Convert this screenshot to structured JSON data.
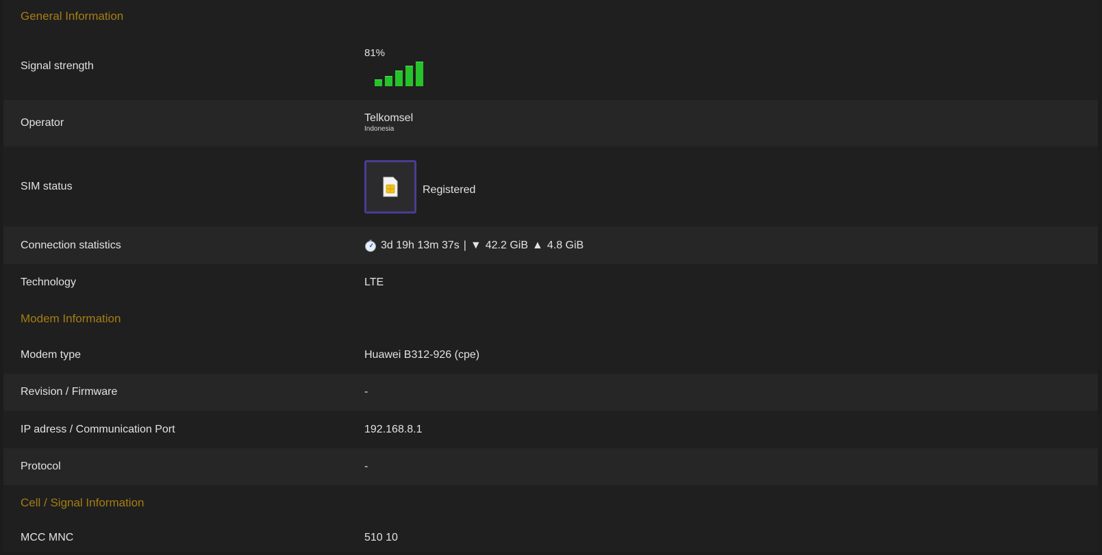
{
  "general": {
    "title": "General Information",
    "signal": {
      "label": "Signal strength",
      "percent_text": "81%",
      "bars_active": 5,
      "bars_total": 5,
      "color": "#27c22a"
    },
    "operator": {
      "label": "Operator",
      "name": "Telkomsel",
      "country": "Indonesia"
    },
    "sim": {
      "label": "SIM status",
      "status": "Registered",
      "icon": "sim-card-icon"
    },
    "connection": {
      "label": "Connection statistics",
      "uptime": "3d 19h 13m 37s",
      "separator": "|",
      "download_arrow": "▼",
      "download": "42.2 GiB",
      "upload_arrow": "▲",
      "upload": "4.8 GiB",
      "icon": "stopwatch-icon"
    },
    "technology": {
      "label": "Technology",
      "value": "LTE"
    }
  },
  "modem": {
    "title": "Modem Information",
    "type": {
      "label": "Modem type",
      "value": "Huawei B312-926 (cpe)"
    },
    "firmware": {
      "label": "Revision / Firmware",
      "value": "-"
    },
    "ip": {
      "label": "IP adress / Communication Port",
      "value": "192.168.8.1"
    },
    "protocol": {
      "label": "Protocol",
      "value": "-"
    }
  },
  "cell": {
    "title": "Cell / Signal Information",
    "mccmnc": {
      "label": "MCC MNC",
      "value": "510 10"
    }
  },
  "colors": {
    "section_title": "#a57e12",
    "accent_border": "#4b3c93",
    "signal_bar": "#27c22a"
  }
}
